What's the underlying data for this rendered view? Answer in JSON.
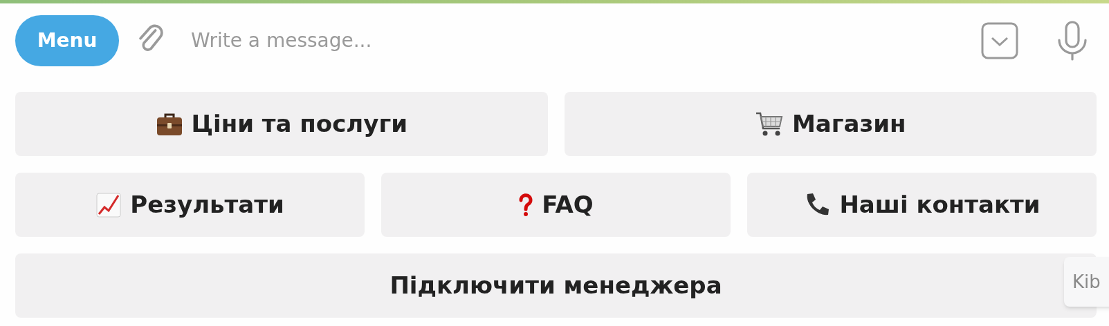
{
  "composer": {
    "menu_button": "Menu",
    "placeholder": "Write a message..."
  },
  "keyboard": [
    [
      {
        "label": "Ціни та послуги",
        "kind": "briefcase"
      },
      {
        "label": "Магазин",
        "kind": "cart"
      }
    ],
    [
      {
        "label": "Результати",
        "kind": "chart"
      },
      {
        "label": "FAQ",
        "kind": "question"
      },
      {
        "label": "Наші контакти",
        "kind": "phone"
      }
    ],
    [
      {
        "label": "Підключити менеджера"
      }
    ]
  ],
  "tooltip": "Kib"
}
